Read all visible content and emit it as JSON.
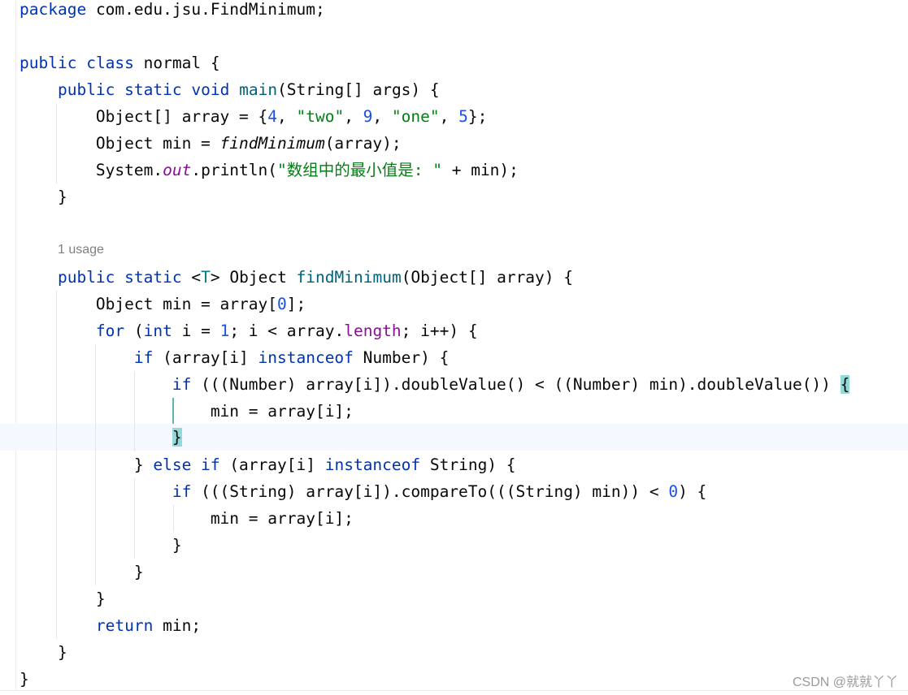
{
  "editor": {
    "package_line": {
      "kw": "package",
      "name": "com.edu.jsu.FindMinimum;"
    },
    "class_decl": {
      "kw1": "public",
      "kw2": "class",
      "name": "normal {"
    },
    "main_decl": {
      "kw1": "public",
      "kw2": "static",
      "kw3": "void",
      "fn": "main",
      "params": "(String[] args) {"
    },
    "main_array": {
      "prefix": "Object[] array = {",
      "n1": "4",
      "s1": "\"two\"",
      "n2": "9",
      "s2": "\"one\"",
      "n3": "5",
      "suffix": "};",
      "sep": ", "
    },
    "main_min": {
      "prefix": "Object min = ",
      "call": "findMinimum",
      "suffix": "(array);"
    },
    "main_print": {
      "obj": "System.",
      "field": "out",
      "method": ".println(",
      "str": "\"数组中的最小值是: \"",
      "suffix": " + min);"
    },
    "close_brace": "}",
    "usage_hint": "1 usage",
    "find_decl": {
      "kw1": "public",
      "kw2": "static",
      "tp_open": "<",
      "tp": "T",
      "tp_close": ">",
      "type": " Object ",
      "fn": "findMinimum",
      "params": "(Object[] array) {"
    },
    "find_min": {
      "prefix": "Object min = array[",
      "num": "0",
      "suffix": "];"
    },
    "for_line": {
      "kw": "for",
      "p1": " (",
      "kw2": "int",
      "p2": " i = ",
      "num": "1",
      "p3": "; i < array.",
      "field": "length",
      "p4": "; i++) {"
    },
    "if_number": {
      "kw": "if",
      "p1": " (array[i] ",
      "kw2": "instanceof",
      "p2": " Number) {"
    },
    "if_compare_num": {
      "kw": "if",
      "code": " (((Number) array[i]).doubleValue() < ((Number) min).doubleValue()) ",
      "brace": "{"
    },
    "assign": "min = array[i];",
    "else_if": {
      "p0": "} ",
      "kw1": "else",
      "kw2": "if",
      "p1": " (array[i] ",
      "kw3": "instanceof",
      "p2": " String) {"
    },
    "if_compare_str": {
      "kw": "if",
      "code": " (((String) array[i]).compareTo(((String) min)) < ",
      "num": "0",
      "suffix": ") {"
    },
    "return_line": {
      "kw": "return",
      "suffix": " min;"
    }
  },
  "watermark": "CSDN @就就丫丫"
}
